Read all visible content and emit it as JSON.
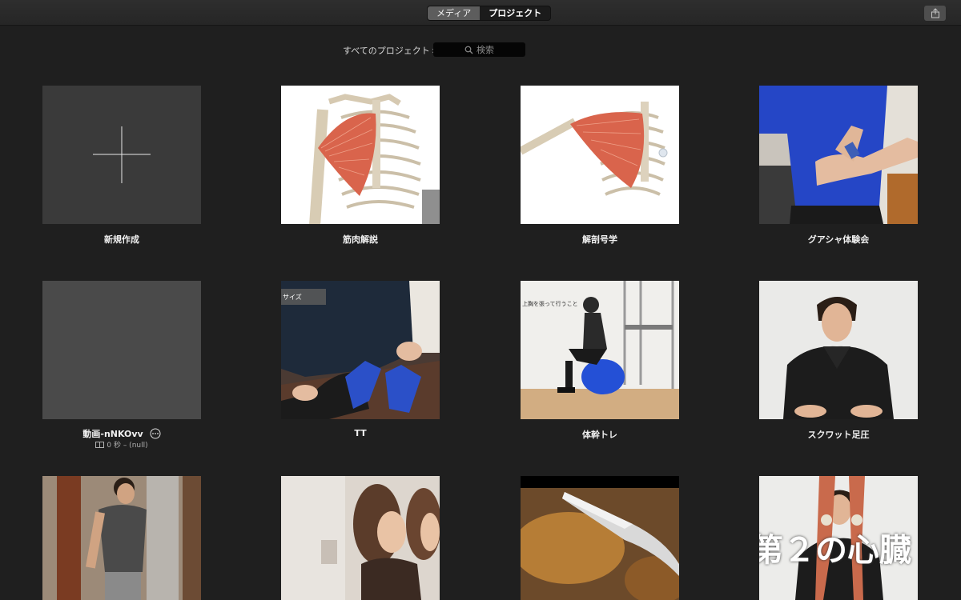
{
  "toolbar": {
    "tabs": [
      {
        "label": "メディア",
        "active": true
      },
      {
        "label": "プロジェクト",
        "active": false
      }
    ]
  },
  "filter": {
    "selector_label": "すべてのプロジェクト",
    "search_placeholder": "検索"
  },
  "projects": [
    {
      "label": "新規作成"
    },
    {
      "label": "筋肉解説"
    },
    {
      "label": "解剖号学"
    },
    {
      "label": "グアシャ体験会"
    },
    {
      "label": "動画-nNKOvv",
      "meta": "0 秒 – (null)"
    },
    {
      "label": "TT",
      "overlay": "サイズ"
    },
    {
      "label": "体幹トレ",
      "overlay": "上胸を張って行うこと"
    },
    {
      "label": "スクワット足圧"
    },
    {
      "label": ""
    },
    {
      "label": ""
    },
    {
      "label": ""
    },
    {
      "label": "",
      "overlay": "第２の心臓"
    }
  ],
  "colors": {
    "background": "#1f1f1f",
    "toolbar": "#2b2b2b",
    "active_tab": "#5d5d5d"
  }
}
